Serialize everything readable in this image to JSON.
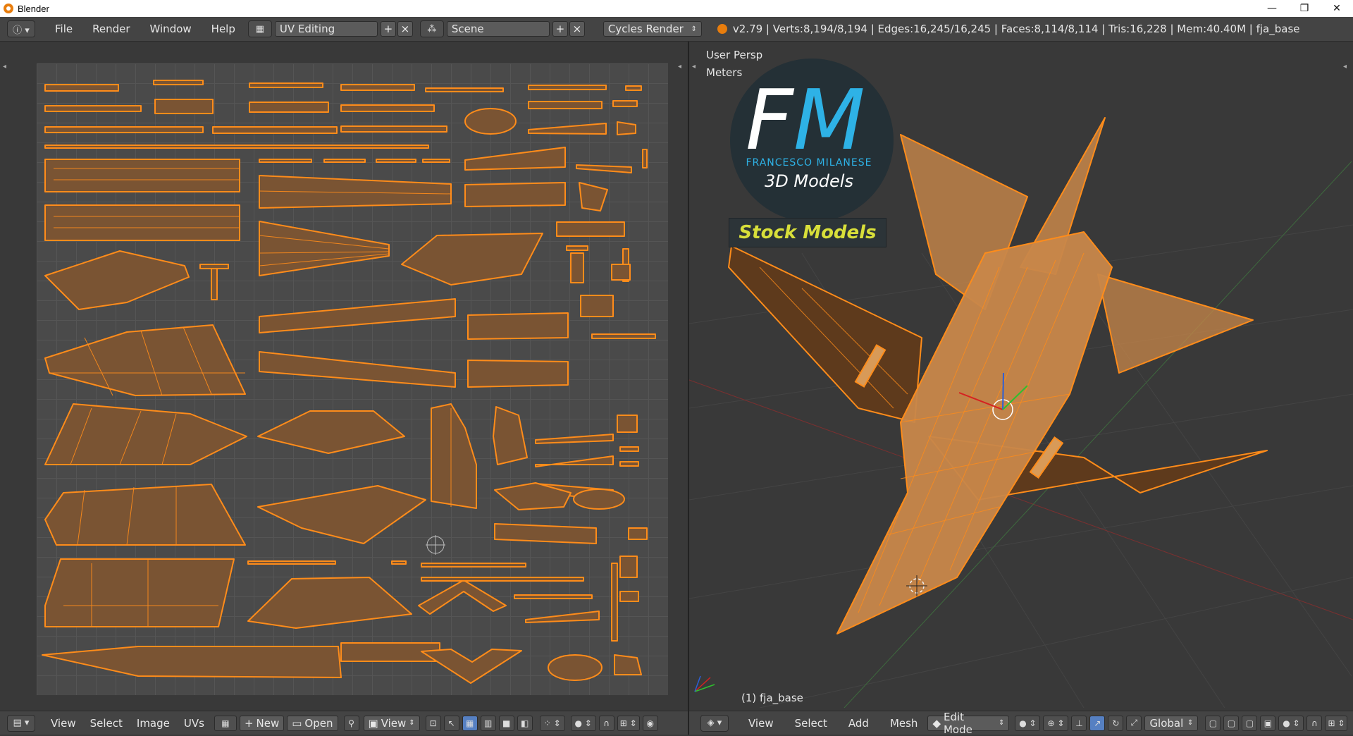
{
  "window": {
    "title": "Blender",
    "controls": {
      "minimize": "—",
      "restore": "❐",
      "close": "✕"
    }
  },
  "info_header": {
    "menus": [
      "File",
      "Render",
      "Window",
      "Help"
    ],
    "screen_layout": "UV Editing",
    "scene": "Scene",
    "render_engine": "Cycles Render",
    "stats": "v2.79 | Verts:8,194/8,194 | Edges:16,245/16,245 | Faces:8,114/8,114 | Tris:16,228 | Mem:40.40M | fja_base"
  },
  "uv_editor": {
    "menus": [
      "View",
      "Select",
      "Image",
      "UVs"
    ],
    "new_label": "New",
    "open_label": "Open",
    "view_label": "View"
  },
  "viewport": {
    "view_name": "User Persp",
    "units": "Meters",
    "object_label": "(1) fja_base",
    "menus": [
      "View",
      "Select",
      "Add",
      "Mesh"
    ],
    "mode": "Edit Mode",
    "orientation": "Global",
    "watermark": {
      "letter_f": "F",
      "letter_m": "M",
      "name": "FRANCESCO MILANESE",
      "subtitle": "3D Models",
      "banner": "Stock Models"
    }
  },
  "colors": {
    "uv_orange": "#ff8c1a",
    "uv_fill": "#7a5433",
    "mesh_fill": "#c8874a",
    "background": "#393939"
  }
}
